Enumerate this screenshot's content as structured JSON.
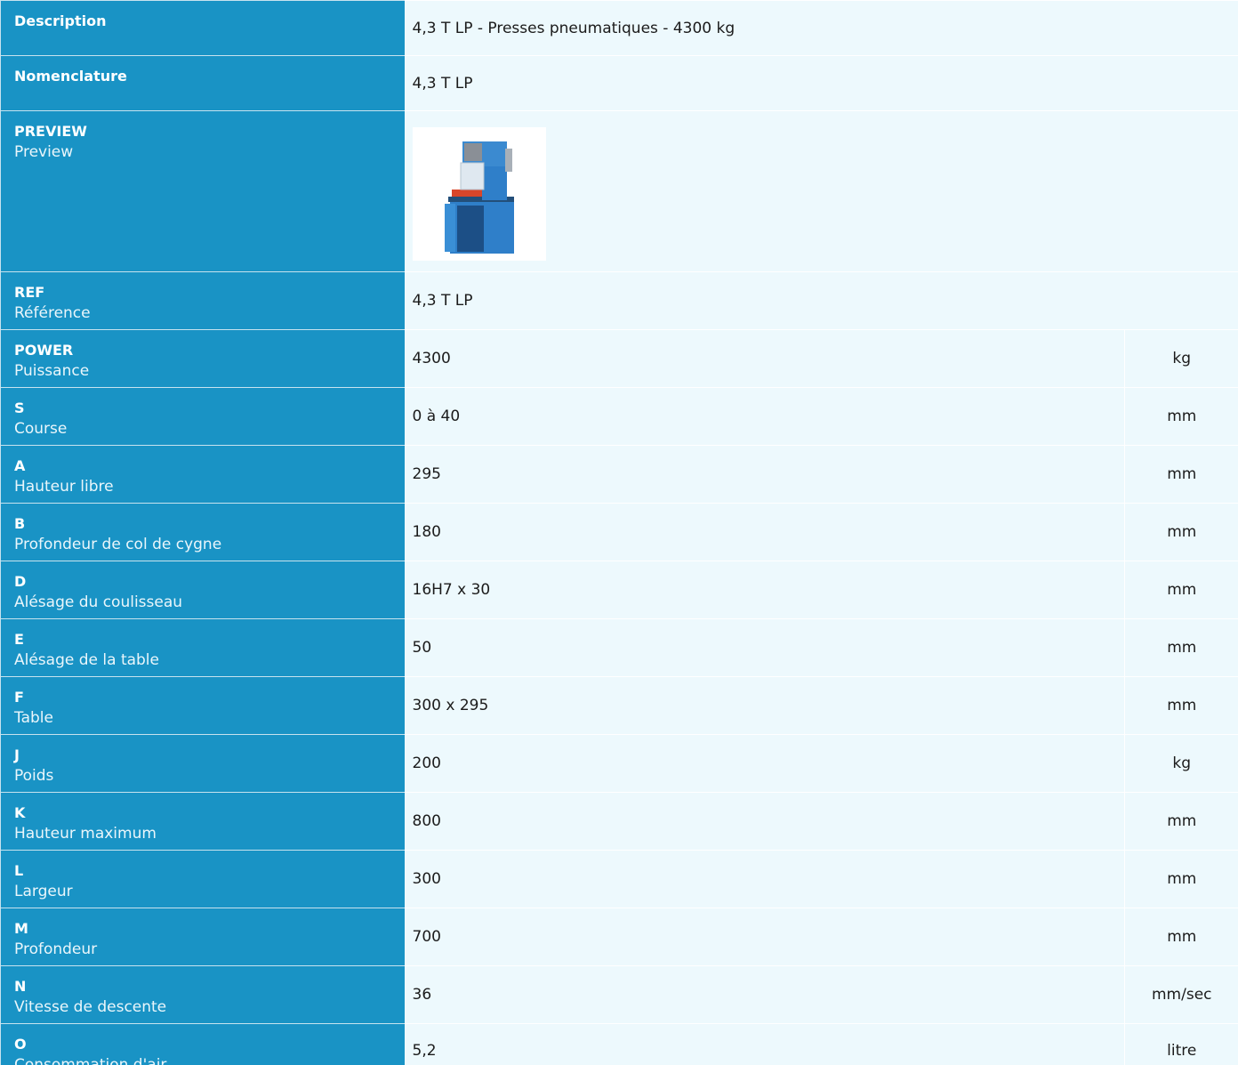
{
  "rows": [
    {
      "code": "Description",
      "name": "",
      "value": "4,3 T LP - Presses pneumatiques - 4300 kg",
      "unit": ""
    },
    {
      "code": "Nomenclature",
      "name": "",
      "value": "4,3 T LP",
      "unit": ""
    },
    {
      "code": "PREVIEW",
      "name": "Preview",
      "value": "",
      "unit": ""
    },
    {
      "code": "REF",
      "name": "Référence",
      "value": "4,3 T LP",
      "unit": ""
    },
    {
      "code": "POWER",
      "name": "Puissance",
      "value": "4300",
      "unit": "kg"
    },
    {
      "code": "S",
      "name": "Course",
      "value": "0 à 40",
      "unit": "mm"
    },
    {
      "code": "A",
      "name": "Hauteur libre",
      "value": "295",
      "unit": "mm"
    },
    {
      "code": "B",
      "name": "Profondeur de col de cygne",
      "value": "180",
      "unit": "mm"
    },
    {
      "code": "D",
      "name": "Alésage du coulisseau",
      "value": "16H7 x 30",
      "unit": "mm"
    },
    {
      "code": "E",
      "name": "Alésage de la table",
      "value": "50",
      "unit": "mm"
    },
    {
      "code": "F",
      "name": "Table",
      "value": "300 x 295",
      "unit": "mm"
    },
    {
      "code": "J",
      "name": "Poids",
      "value": "200",
      "unit": "kg"
    },
    {
      "code": "K",
      "name": "Hauteur maximum",
      "value": "800",
      "unit": "mm"
    },
    {
      "code": "L",
      "name": "Largeur",
      "value": "300",
      "unit": "mm"
    },
    {
      "code": "M",
      "name": "Profondeur",
      "value": "700",
      "unit": "mm"
    },
    {
      "code": "N",
      "name": "Vitesse de descente",
      "value": "36",
      "unit": "mm/sec"
    },
    {
      "code": "O",
      "name": "Consommation d'air",
      "value": "5,2",
      "unit": "litre"
    }
  ],
  "preview_image": {
    "icon": "pneumatic-press-image",
    "colors": {
      "frame": "#2f7fc9",
      "dark": "#1c4f86",
      "table": "#d9462a",
      "motor": "#8a8f96"
    }
  }
}
